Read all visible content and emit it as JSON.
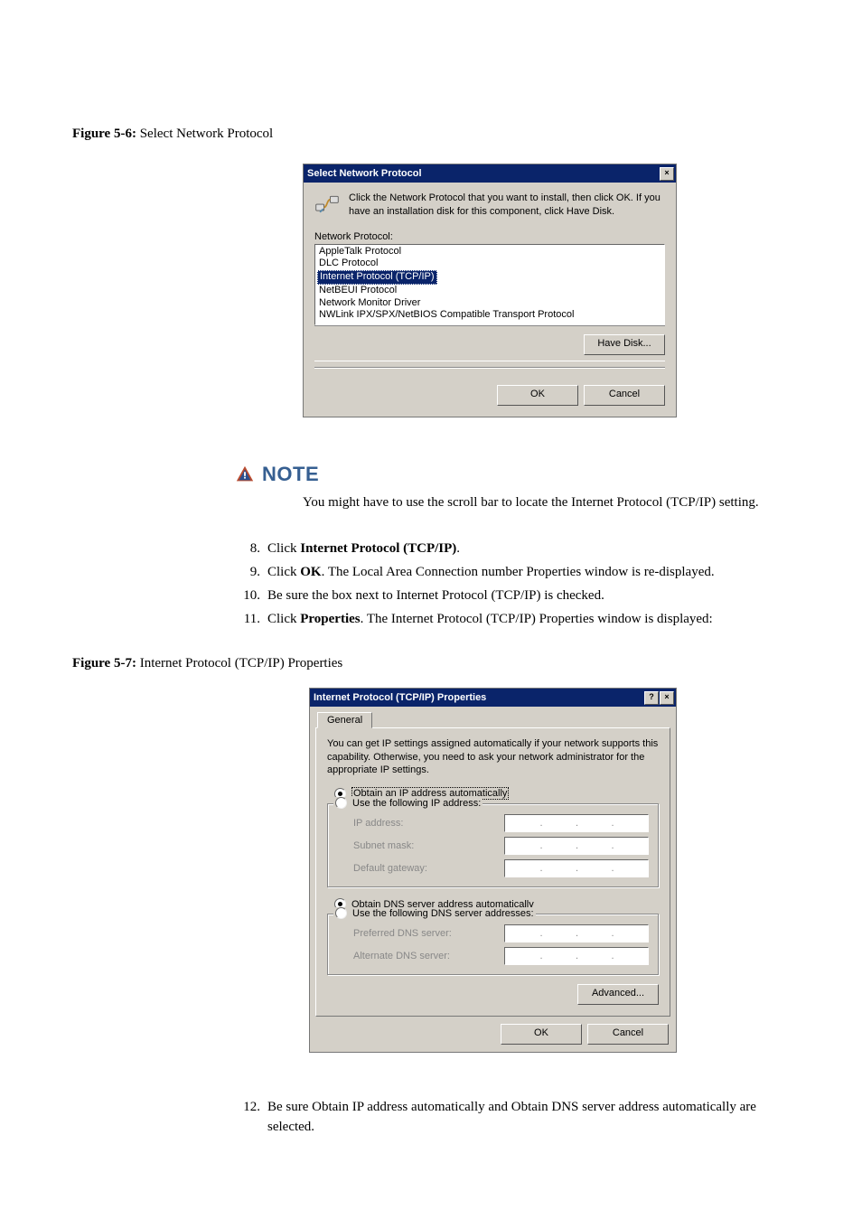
{
  "figure1": {
    "num": "Figure 5-6:",
    "title": "Select Network Protocol"
  },
  "snp": {
    "title": "Select Network Protocol",
    "close_glyph": "×",
    "help_glyph": "?",
    "instr": "Click the Network Protocol that you want to install, then click OK. If you have an installation disk for this component, click Have Disk.",
    "list_label": "Network Protocol:",
    "items": [
      "AppleTalk Protocol",
      "DLC Protocol",
      "Internet Protocol (TCP/IP)",
      "NetBEUI Protocol",
      "Network Monitor Driver",
      "NWLink IPX/SPX/NetBIOS Compatible Transport Protocol"
    ],
    "have_disk": "Have Disk...",
    "ok": "OK",
    "cancel": "Cancel"
  },
  "note": {
    "label": "NOTE",
    "text": "You might have to use the scroll bar to locate the Internet Protocol (TCP/IP) setting."
  },
  "steps": {
    "s8": {
      "n": "8.",
      "pre": "Click ",
      "bold": "Internet Protocol (TCP/IP)",
      "post": "."
    },
    "s9": {
      "n": "9.",
      "pre": "Click ",
      "bold": "OK",
      "post": ". The Local Area Connection number Properties window is re-displayed."
    },
    "s10": {
      "n": "10.",
      "text": "Be sure the box next to Internet Protocol (TCP/IP) is checked."
    },
    "s11": {
      "n": "11.",
      "pre": "Click ",
      "bold": "Properties",
      "post": ". The Internet Protocol (TCP/IP) Properties window is displayed:"
    },
    "s12": {
      "n": "12.",
      "text": "Be sure Obtain IP address automatically and Obtain DNS server address automatically are selected."
    }
  },
  "figure2": {
    "num": "Figure 5-7:",
    "title": "Internet Protocol (TCP/IP) Properties"
  },
  "ipp": {
    "title": "Internet Protocol (TCP/IP) Properties",
    "tab": "General",
    "intro": "You can get IP settings assigned automatically if your network supports this capability. Otherwise, you need to ask your network administrator for the appropriate IP settings.",
    "r_auto_ip": "Obtain an IP address automatically",
    "r_use_ip": "Use the following IP address:",
    "lbl_ip": "IP address:",
    "lbl_mask": "Subnet mask:",
    "lbl_gw": "Default gateway:",
    "r_auto_dns": "Obtain DNS server address automatically",
    "r_use_dns": "Use the following DNS server addresses:",
    "lbl_pdns": "Preferred DNS server:",
    "lbl_adns": "Alternate DNS server:",
    "advanced": "Advanced...",
    "ok": "OK",
    "cancel": "Cancel"
  }
}
